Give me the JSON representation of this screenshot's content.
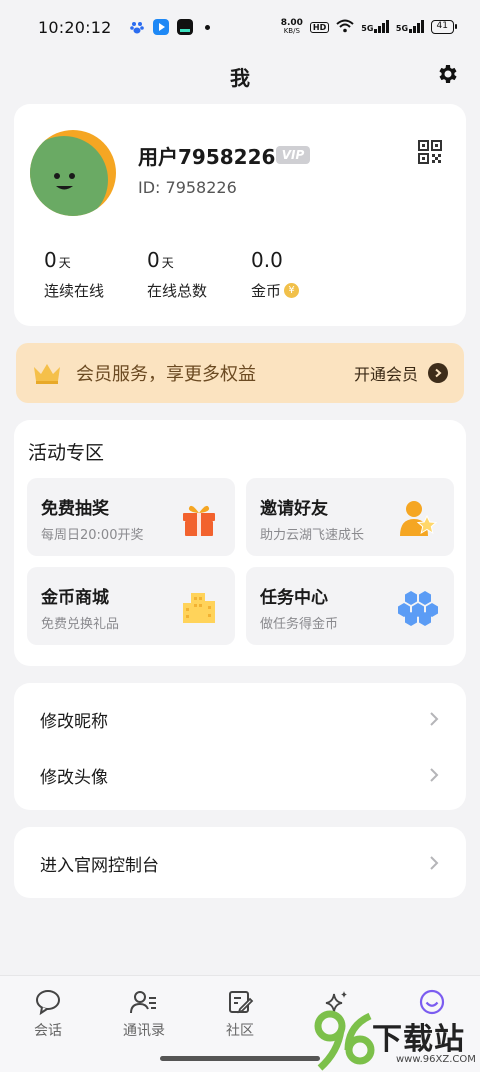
{
  "status_bar": {
    "time": "10:20:12",
    "net_speed": "8.00",
    "net_unit": "KB/S",
    "hd": "HD",
    "signal1": "5G",
    "signal2": "5G",
    "battery": "41"
  },
  "header": {
    "title": "我"
  },
  "profile": {
    "name": "用户7958226",
    "vip": "VIP",
    "id": "ID: 7958226",
    "stats": [
      {
        "value": "0",
        "unit": "天",
        "label": "连续在线"
      },
      {
        "value": "0",
        "unit": "天",
        "label": "在线总数"
      },
      {
        "value": "0.0",
        "unit": "",
        "label": "金币"
      }
    ]
  },
  "vip_banner": {
    "text": "会员服务，享更多权益",
    "action": "开通会员"
  },
  "activities": {
    "title": "活动专区",
    "items": [
      {
        "title": "免费抽奖",
        "subtitle": "每周日20:00开奖",
        "icon": "gift-icon"
      },
      {
        "title": "邀请好友",
        "subtitle": "助力云湖飞速成长",
        "icon": "invite-user-icon"
      },
      {
        "title": "金币商城",
        "subtitle": "免费兑换礼品",
        "icon": "building-icon"
      },
      {
        "title": "任务中心",
        "subtitle": "做任务得金币",
        "icon": "hexagon-cluster-icon"
      }
    ]
  },
  "menu": {
    "items": [
      {
        "label": "修改昵称"
      },
      {
        "label": "修改头像"
      }
    ],
    "console": {
      "label": "进入官网控制台"
    }
  },
  "bottom_nav": {
    "items": [
      {
        "label": "会话",
        "icon": "chat-bubble-icon"
      },
      {
        "label": "通讯录",
        "icon": "contacts-icon"
      },
      {
        "label": "社区",
        "icon": "community-icon"
      },
      {
        "label": "",
        "icon": "sparkle-icon"
      },
      {
        "label": "",
        "icon": "smile-icon"
      }
    ]
  },
  "watermark": {
    "text": "下载站",
    "url": "www.96XZ.COM"
  },
  "colors": {
    "background": "#f3f3f5",
    "vip_banner": "#fbe3c0",
    "avatar_green": "#6aaa64",
    "avatar_orange": "#f5a623",
    "accent_purple": "#7b5cf0"
  }
}
